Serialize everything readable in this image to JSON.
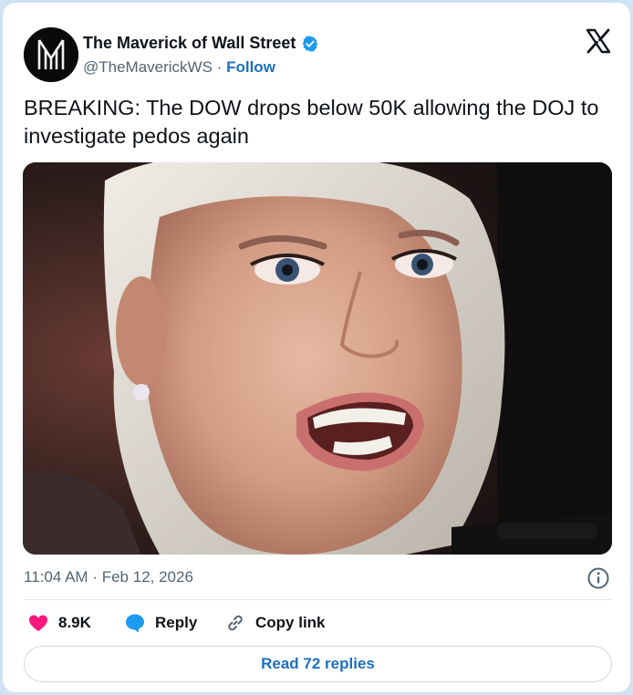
{
  "author": {
    "display_name": "The Maverick of Wall Street",
    "handle": "@TheMaverickWS",
    "separator": "·",
    "follow_label": "Follow",
    "verified": true
  },
  "tweet": {
    "text": "BREAKING: The DOW drops below 50K allowing the DOJ to investigate pedos again",
    "time": "11:04 AM",
    "date": "Feb 12, 2026"
  },
  "actions": {
    "likes": "8.9K",
    "reply_label": "Reply",
    "copy_link_label": "Copy link"
  },
  "read_replies_label": "Read 72 replies",
  "icons": {
    "brand": "x-logo-icon",
    "verified": "verified-badge-icon",
    "info": "info-icon",
    "like": "heart-icon",
    "reply": "speech-bubble-icon",
    "copy": "link-icon"
  },
  "colors": {
    "like": "#f91880",
    "reply": "#1d9bf0",
    "link": "#1d6fbf",
    "text": "#0f1419",
    "muted": "#536471"
  }
}
